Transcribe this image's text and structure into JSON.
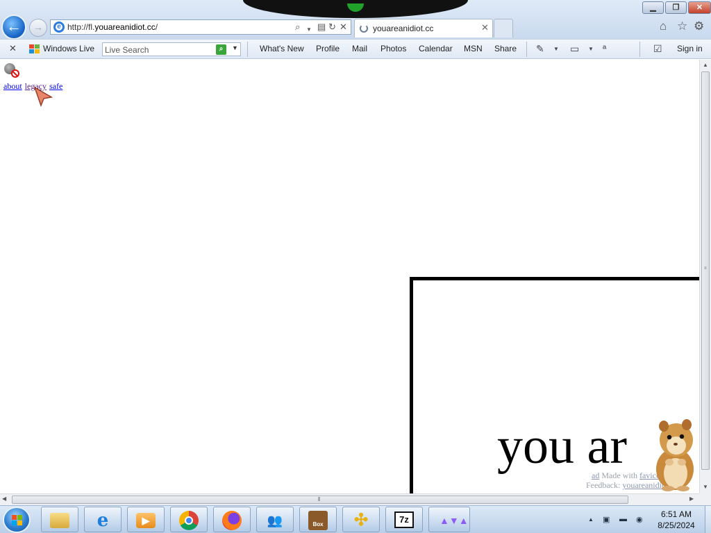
{
  "browser": {
    "url_prefix": "http://fl.",
    "url_domain": "youareanidiot.cc",
    "url_suffix": "/",
    "tab_title": "youareanidiot.cc"
  },
  "command_bar": {
    "windows_live_label": "Windows Live",
    "live_search_placeholder": "Live Search",
    "links": [
      "What's New",
      "Profile",
      "Mail",
      "Photos",
      "Calendar",
      "MSN",
      "Share"
    ],
    "sign_in": "Sign in"
  },
  "page": {
    "nav_links": [
      "about",
      "legacy",
      "safe"
    ],
    "headline": "you ar",
    "footer_small": "ad",
    "footer_made_with": "Made with",
    "footer_feedback_label": "Feedback:",
    "footer_feedback_link": "youareanidiot.cc",
    "footer_made_with_link": "favicon"
  },
  "taskbar": {
    "apps": [
      "file-explorer",
      "internet-explorer",
      "media-player",
      "chrome",
      "firefox",
      "users-switch",
      "hamster-box",
      "yellow-arrows",
      "7zip",
      "winamp-like"
    ],
    "seven_zip_label": "7z",
    "box_label": "Box",
    "time": "6:51 AM",
    "date": "8/25/2024"
  },
  "colors": {
    "link": "#0000ee",
    "visited_link": "#551a8b",
    "chrome_bar": "#dfeaf7",
    "taskbar": "#c9dcf0"
  }
}
